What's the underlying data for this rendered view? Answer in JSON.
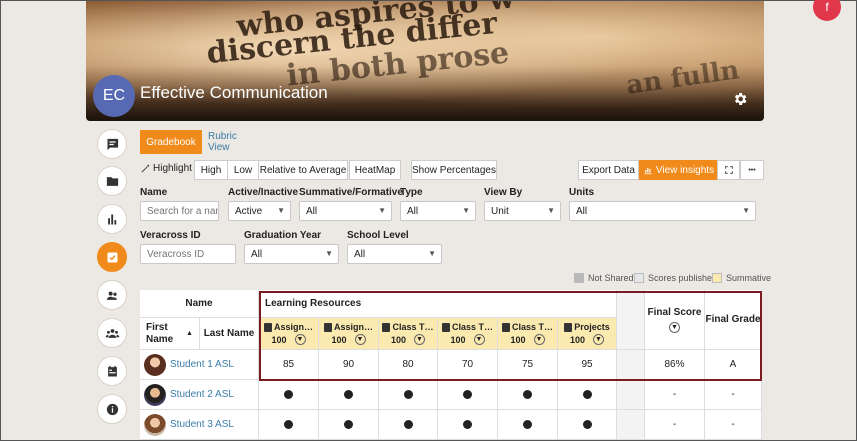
{
  "course": {
    "initials": "EC",
    "title": "Effective Communication",
    "banner_text": [
      "who aspires to w",
      "discern the differ",
      "in both prose",
      "an fulln"
    ]
  },
  "profile_badge": "f",
  "tabs": [
    {
      "label": "Gradebook"
    },
    {
      "label": "Rubric View"
    }
  ],
  "toolbar": {
    "highlight_label": "Highlight :",
    "high": "High",
    "low": "Low",
    "relative": "Relative to Average",
    "heatmap": "HeatMap",
    "show_percentages": "Show Percentages",
    "export": "Export Data",
    "insights": "View insights",
    "more": "•••"
  },
  "filters": {
    "name": {
      "label": "Name",
      "placeholder": "Search for a nam"
    },
    "active": {
      "label": "Active/Inactive",
      "value": "Active"
    },
    "summative": {
      "label": "Summative/Formative",
      "value": "All"
    },
    "type": {
      "label": "Type",
      "value": "All"
    },
    "view_by": {
      "label": "View By",
      "value": "Unit"
    },
    "units": {
      "label": "Units",
      "value": "All"
    },
    "veracross": {
      "label": "Veracross ID",
      "placeholder": "Veracross ID"
    },
    "grad_year": {
      "label": "Graduation Year",
      "value": "All"
    },
    "school_level": {
      "label": "School Level",
      "value": "All"
    }
  },
  "legend": {
    "not_shared": "Not Shared",
    "scores_published": "Scores published",
    "summative": "Summative",
    "colors": {
      "not_shared": "#b8b8b8",
      "scores_published": "#e4e6ea",
      "summative": "#fbeab0"
    }
  },
  "table": {
    "name_header": "Name",
    "first_name": "First Name",
    "last_name": "Last Name",
    "group_header": "Learning Resources",
    "final_score": "Final Score",
    "final_grade": "Final Grade",
    "assignments": [
      {
        "title": "Assign…",
        "points": "100"
      },
      {
        "title": "Assign…",
        "points": "100"
      },
      {
        "title": "Class T…",
        "points": "100"
      },
      {
        "title": "Class T…",
        "points": "100"
      },
      {
        "title": "Class T…",
        "points": "100"
      },
      {
        "title": "Projects",
        "points": "100"
      }
    ],
    "rows": [
      {
        "name": "Student 1 ASL",
        "scores": [
          "85",
          "90",
          "80",
          "70",
          "75",
          "95"
        ],
        "final_score": "86%",
        "final_grade": "A"
      },
      {
        "name": "Student 2 ASL",
        "scores": [
          "●",
          "●",
          "●",
          "●",
          "●",
          "●"
        ],
        "final_score": "-",
        "final_grade": "-"
      },
      {
        "name": "Student 3 ASL",
        "scores": [
          "●",
          "●",
          "●",
          "●",
          "●",
          "●"
        ],
        "final_score": "-",
        "final_grade": "-"
      }
    ]
  }
}
